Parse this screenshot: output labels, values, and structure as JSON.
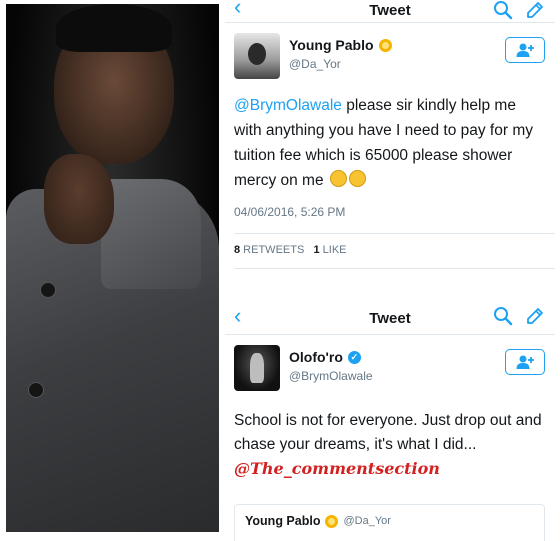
{
  "tweet1": {
    "nav": {
      "title": "Tweet"
    },
    "author": {
      "name": "Young Pablo",
      "handle": "@Da_Yor"
    },
    "text": {
      "mention": "@BrymOlawale",
      "body": " please sir kindly help me with anything you have I need to pay for my tuition fee which is 65000 please shower mercy on me"
    },
    "timestamp": "04/06/2016, 5:26 PM",
    "stats": {
      "retweets_count": "8",
      "retweets_label": " RETWEETS",
      "likes_count": "1",
      "likes_label": " LIKE"
    }
  },
  "tweet2": {
    "nav": {
      "title": "Tweet"
    },
    "author": {
      "name": "Olofo'ro",
      "handle": "@BrymOlawale"
    },
    "text": {
      "body": "School is not for everyone. Just drop out and chase your dreams, it's what I did... ",
      "watermark": "@The_commentsection"
    },
    "quoted": {
      "name": "Young Pablo",
      "handle": "@Da_Yor"
    }
  },
  "colors": {
    "twitter_blue": "#1da1f2",
    "text_primary": "#14171a",
    "text_secondary": "#657786",
    "watermark_red": "#d32020",
    "verified_gold": "#f5b400"
  },
  "icons": {
    "back": "chevron-left-icon",
    "search": "search-icon",
    "compose": "compose-icon",
    "follow": "add-user-icon"
  }
}
